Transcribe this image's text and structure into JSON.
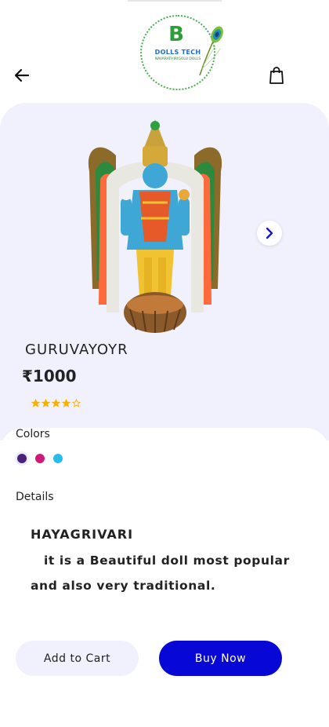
{
  "header": {
    "logo": {
      "title": "DOLLS TECH",
      "subtitle": "NAVARATHIRIGOLU DOLLS",
      "icon": "peacock-feather-icon"
    },
    "back_icon": "arrow-left-icon",
    "cart_icon": "shopping-bag-icon"
  },
  "product": {
    "image": "guruvayur-doll-image",
    "name": "GURUVAYOYR",
    "price": "₹1000",
    "rating": 4,
    "rating_max": 5,
    "next_icon": "chevron-right-icon"
  },
  "colors": {
    "label": "Colors",
    "options": [
      "#4a2277",
      "#d1197a",
      "#27bde8"
    ],
    "selected_index": 0
  },
  "details": {
    "label": "Details",
    "title": "HAYAGRIVARI",
    "body": "it is a Beautiful doll most popular and also very traditional."
  },
  "actions": {
    "add_to_cart": "Add to Cart",
    "buy_now": "Buy Now"
  },
  "theme": {
    "accent": "#0707d6",
    "light_bg": "#f1f0fd",
    "star_color": "#f5b300"
  }
}
